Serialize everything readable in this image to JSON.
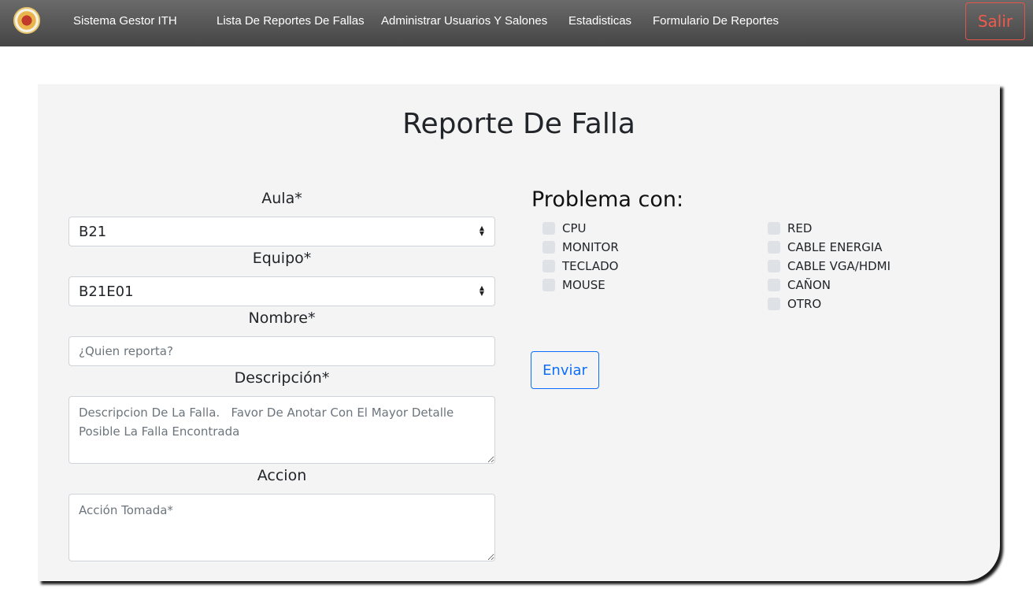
{
  "navbar": {
    "brand": "Sistema Gestor ITH",
    "links": [
      "Lista De Reportes De Fallas",
      "Administrar Usuarios Y Salones",
      "Estadisticas",
      "Formulario De Reportes"
    ],
    "logout_label": "Salir"
  },
  "form": {
    "title": "Reporte De Falla",
    "aula": {
      "label": "Aula*",
      "value": "B21"
    },
    "equipo": {
      "label": "Equipo*",
      "value": "B21E01"
    },
    "nombre": {
      "label": "Nombre*",
      "placeholder": "¿Quien reporta?"
    },
    "descripcion": {
      "label": "Descripción*",
      "placeholder": "Descripcion De La Falla.   Favor De Anotar Con El Mayor Detalle Posible La Falla Encontrada"
    },
    "accion": {
      "label": "Accion",
      "placeholder": "Acción Tomada*"
    },
    "problema": {
      "heading": "Problema con:",
      "col1": [
        "CPU",
        "MONITOR",
        "TECLADO",
        "MOUSE"
      ],
      "col2": [
        "RED",
        "CABLE ENERGIA",
        "CABLE VGA/HDMI",
        "CAÑON",
        "OTRO"
      ]
    },
    "submit_label": "Enviar"
  },
  "colors": {
    "navbar": "#555555",
    "logout": "#ef5b4c",
    "primary": "#0d6efd",
    "card": "#f4f4f4"
  }
}
